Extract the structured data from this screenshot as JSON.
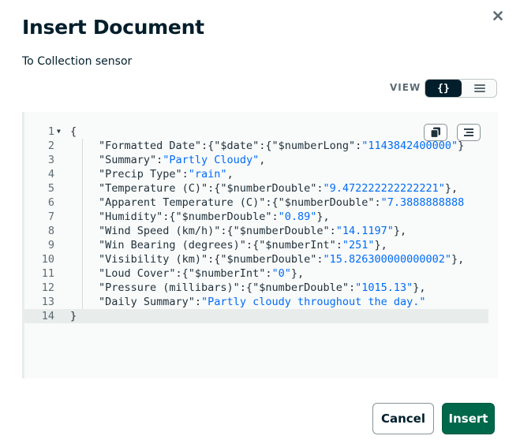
{
  "modal": {
    "title": "Insert Document",
    "subtitle": "To Collection sensor",
    "view_label": "VIEW",
    "view_toggle": {
      "json_label": "{}",
      "selected": "json"
    },
    "cancel_label": "Cancel",
    "insert_label": "Insert"
  },
  "editor": {
    "lines": [
      {
        "n": "1",
        "segs": [
          {
            "t": "{"
          }
        ]
      },
      {
        "n": "2",
        "segs": [
          {
            "t": "\"Formatted Date\":{\"$date\":{\"$numberLong\":"
          },
          {
            "t": "\"1143842400000\"",
            "c": "str"
          },
          {
            "t": "}"
          }
        ]
      },
      {
        "n": "3",
        "segs": [
          {
            "t": "\"Summary\":"
          },
          {
            "t": "\"Partly Cloudy\"",
            "c": "str"
          },
          {
            "t": ","
          }
        ]
      },
      {
        "n": "4",
        "segs": [
          {
            "t": "\"Precip Type\":"
          },
          {
            "t": "\"rain\"",
            "c": "str"
          },
          {
            "t": ","
          }
        ]
      },
      {
        "n": "5",
        "segs": [
          {
            "t": "\"Temperature (C)\":{\"$numberDouble\":"
          },
          {
            "t": "\"9.472222222222221\"",
            "c": "str"
          },
          {
            "t": "},"
          }
        ]
      },
      {
        "n": "6",
        "segs": [
          {
            "t": "\"Apparent Temperature (C)\":{\"$numberDouble\":"
          },
          {
            "t": "\"7.3888888888",
            "c": "str"
          }
        ]
      },
      {
        "n": "7",
        "segs": [
          {
            "t": "\"Humidity\":{\"$numberDouble\":"
          },
          {
            "t": "\"0.89\"",
            "c": "str"
          },
          {
            "t": "},"
          }
        ]
      },
      {
        "n": "8",
        "segs": [
          {
            "t": "\"Wind Speed (km/h)\":{\"$numberDouble\":"
          },
          {
            "t": "\"14.1197\"",
            "c": "str"
          },
          {
            "t": "},"
          }
        ]
      },
      {
        "n": "9",
        "segs": [
          {
            "t": "\"Win Bearing (degrees)\":{\"$numberInt\":"
          },
          {
            "t": "\"251\"",
            "c": "str"
          },
          {
            "t": "},"
          }
        ]
      },
      {
        "n": "10",
        "segs": [
          {
            "t": "\"Visibility (km)\":{\"$numberDouble\":"
          },
          {
            "t": "\"15.826300000000002\"",
            "c": "str"
          },
          {
            "t": "},"
          }
        ]
      },
      {
        "n": "11",
        "segs": [
          {
            "t": "\"Loud Cover\":{\"$numberInt\":"
          },
          {
            "t": "\"0\"",
            "c": "str"
          },
          {
            "t": "},"
          }
        ]
      },
      {
        "n": "12",
        "segs": [
          {
            "t": "\"Pressure (millibars)\":{\"$numberDouble\":"
          },
          {
            "t": "\"1015.13\"",
            "c": "str"
          },
          {
            "t": "},"
          }
        ]
      },
      {
        "n": "13",
        "segs": [
          {
            "t": "\"Daily Summary\":"
          },
          {
            "t": "\"Partly cloudy throughout the day.\"",
            "c": "str"
          }
        ]
      },
      {
        "n": "14",
        "segs": [
          {
            "t": "}"
          }
        ]
      }
    ]
  },
  "colors": {
    "title": "#001e2b",
    "string_value": "#016bf8",
    "primary_button": "#00684a",
    "toggle_active": "#001e2b"
  },
  "icons": [
    "close-icon",
    "list-icon",
    "copy-icon",
    "format-icon",
    "fold-arrow-icon"
  ]
}
